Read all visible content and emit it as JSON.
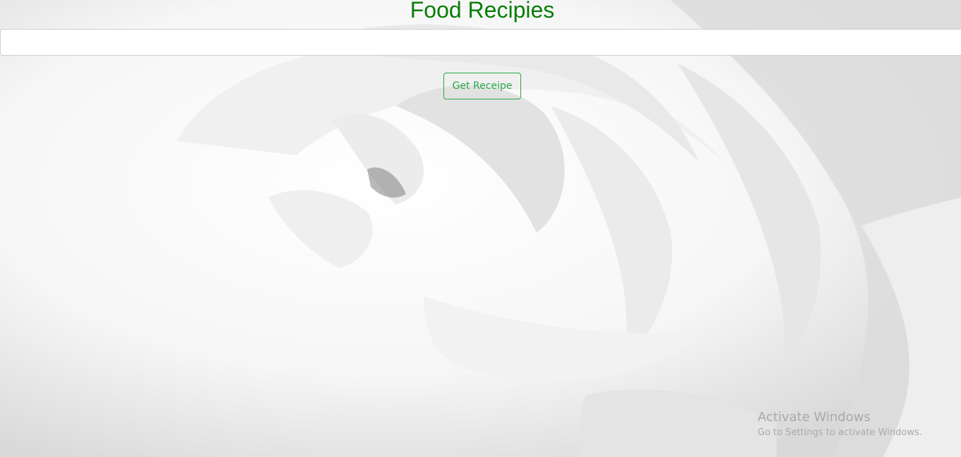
{
  "page": {
    "title": "Food Recipies",
    "title_color": "#0a7d0a",
    "search": {
      "value": "",
      "placeholder": ""
    },
    "button": {
      "label": "Get Receipe",
      "color": "#28a745"
    }
  },
  "background": {
    "description_icon": "flower-background-image"
  },
  "watermark": {
    "title": "Activate Windows",
    "subtitle": "Go to Settings to activate Windows."
  }
}
